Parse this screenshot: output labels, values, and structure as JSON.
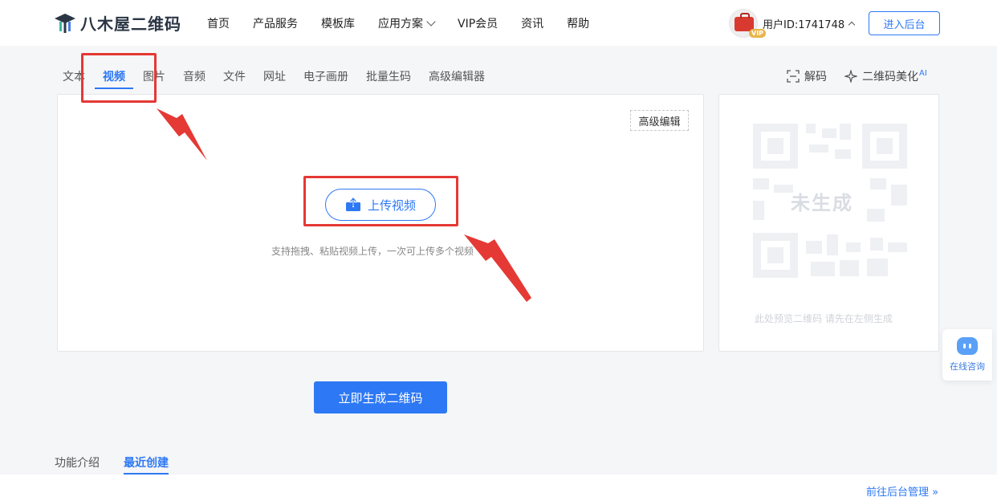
{
  "header": {
    "logo_text": "八木屋二维码",
    "nav": [
      "首页",
      "产品服务",
      "模板库",
      "应用方案",
      "VIP会员",
      "资讯",
      "帮助"
    ],
    "user_id": "用户ID:1741748",
    "vip_badge": "VIP",
    "enter_button": "进入后台"
  },
  "tabs": {
    "items": [
      "文本",
      "视频",
      "图片",
      "音频",
      "文件",
      "网址",
      "电子画册",
      "批量生码",
      "高级编辑器"
    ],
    "active": "视频"
  },
  "tools": {
    "decode": "解码",
    "beautify": "二维码美化",
    "beautify_tag": "AI"
  },
  "editor": {
    "advanced_edit": "高级编辑",
    "upload_button": "上传视频",
    "hint": "支持拖拽、粘贴视频上传，一次可上传多个视频"
  },
  "preview": {
    "qr_label": "未生成",
    "note": "此处预览二维码 请先在左侧生成"
  },
  "generate_button": "立即生成二维码",
  "bottom": {
    "tabs": [
      "功能介绍",
      "最近创建"
    ],
    "active": "最近创建",
    "manage_link": "前往后台管理 »"
  },
  "consult": {
    "label": "在线咨询"
  },
  "colors": {
    "accent": "#2d78f4",
    "annotation": "#e53935"
  },
  "icons": [
    "logo-icon",
    "chevron-down-icon",
    "chevron-up-icon",
    "scan-icon",
    "sparkle-icon",
    "upload-video-icon",
    "qr-placeholder-icon",
    "chat-bot-icon"
  ]
}
